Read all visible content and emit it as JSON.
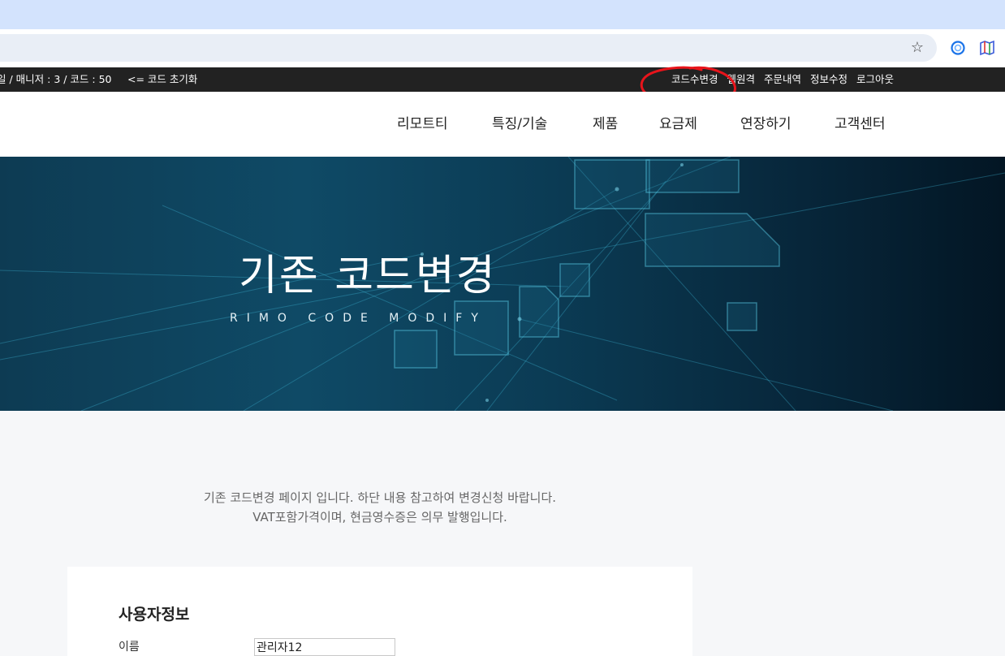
{
  "browser": {
    "star_icon": "star-icon",
    "extensions": [
      "circle-extension-icon",
      "map-extension-icon"
    ]
  },
  "topbar": {
    "status_text": "일 / 매니저 : 3 / 코드 : 50",
    "reset_link": "<= 코드 초기화",
    "links": [
      "코드수변경",
      "웹원격",
      "주문내역",
      "정보수정",
      "로그아웃"
    ],
    "highlight_color": "#e8141b"
  },
  "nav": {
    "items": [
      "리모트티",
      "특징/기술",
      "제품",
      "요금제",
      "연장하기",
      "고객센터"
    ]
  },
  "hero": {
    "title": "기존 코드변경",
    "subtitle": "RIMO CODE MODIFY"
  },
  "intro": {
    "line1": "기존 코드변경 페이지 입니다. 하단 내용 참고하여 변경신청 바랍니다.",
    "line2": "VAT포함가격이며, 현금영수증은 의무 발행입니다."
  },
  "user_info": {
    "title": "사용자정보",
    "name_label": "이름",
    "name_value": "관리자12"
  }
}
